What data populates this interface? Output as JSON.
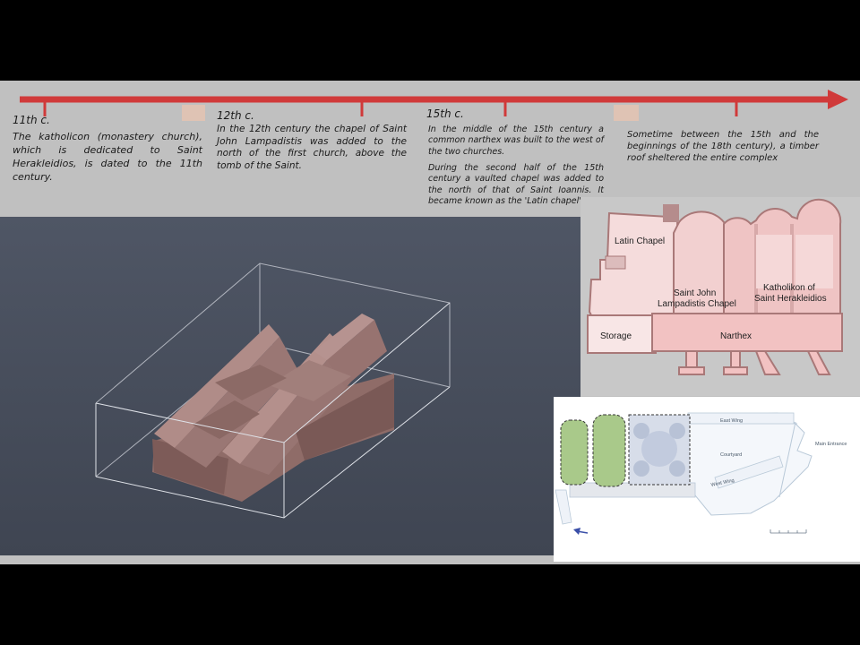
{
  "timeline": [
    {
      "period": "11th c.",
      "text": "The katholicon (monastery church), which is dedicated to Saint Herakleidios, is dated to the 11th century."
    },
    {
      "period": "12th c.",
      "text": "In the 12th century the chapel of Saint John Lampadistis was added to the north of the first church, above the tomb of the Saint."
    },
    {
      "period": "15th c.",
      "text": "In the middle of the 15th century a common narthex was built to the west of the two churches.",
      "text2": "During the second half of the 15th century a vaulted chapel was added to the north of that of Saint Ioannis. It became known as the 'Latin chapel'."
    },
    {
      "period": "",
      "text": "Sometime between the 15th and the beginnings of the 18th century), a timber roof sheltered the entire complex"
    }
  ],
  "plan": {
    "labels": {
      "latin": "Latin Chapel",
      "john_line1": "Saint John",
      "john_line2": "Lampadistis Chapel",
      "katholikon_line1": "Katholikon of",
      "katholikon_line2": "Saint Herakleidios",
      "storage": "Storage",
      "narthex": "Narthex"
    },
    "colors": {
      "light": "#f5dcdc",
      "mid": "#efc4c4",
      "wall": "#a97878"
    }
  },
  "site_plan": {
    "labels": {
      "east_wing": "East Wing",
      "courtyard": "Courtyard",
      "west_wing": "West Wing",
      "main_entrance": "Main Entrance"
    },
    "colors": {
      "green": "#a9c98a",
      "blue": "#c7d0e2",
      "outline": "#b9c9d8"
    }
  },
  "colors": {
    "timeline_arrow": "#d03a3a",
    "model": "#a07e7a"
  }
}
